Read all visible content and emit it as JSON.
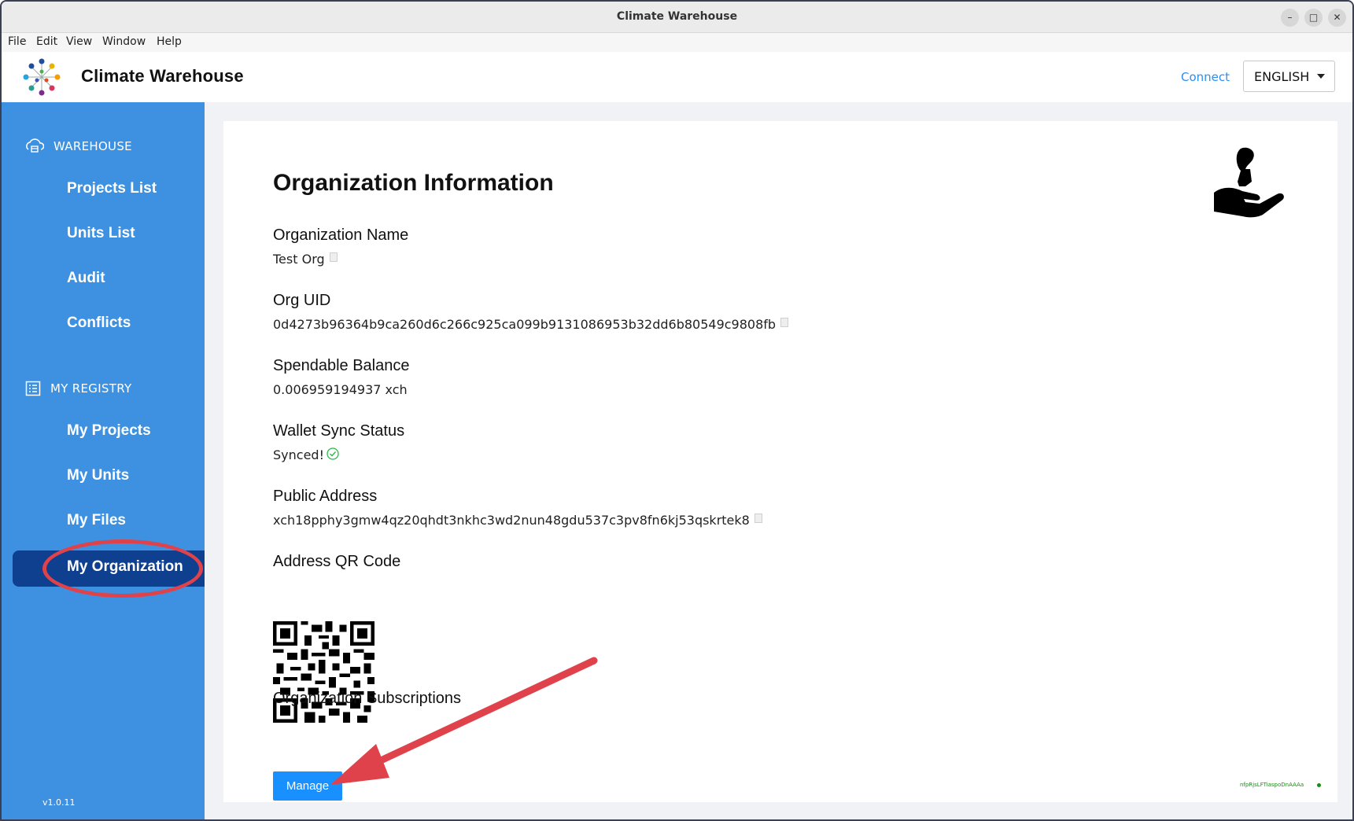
{
  "window": {
    "title": "Climate Warehouse"
  },
  "menu": [
    "File",
    "Edit",
    "View",
    "Window",
    "Help"
  ],
  "header": {
    "app_name": "Climate Warehouse",
    "connect": "Connect",
    "language": "ENGLISH"
  },
  "sidebar": {
    "warehouse_label": "WAREHOUSE",
    "warehouse_items": [
      "Projects List",
      "Units List",
      "Audit",
      "Conflicts"
    ],
    "registry_label": "MY REGISTRY",
    "registry_items": [
      "My Projects",
      "My Units",
      "My Files",
      "My Organization"
    ],
    "active_item": "My Organization",
    "version": "v1.0.11"
  },
  "content": {
    "title": "Organization Information",
    "fields": [
      {
        "label": "Organization Name",
        "value": "Test Org"
      },
      {
        "label": "Org UID",
        "value": "0d4273b96364b9ca260d6c266c925ca099b9131086953b32dd6b80549c9808fb"
      },
      {
        "label": "Spendable Balance",
        "value": "0.006959194937 xch"
      },
      {
        "label": "Wallet Sync Status",
        "value": "Synced!"
      },
      {
        "label": "Public Address",
        "value": "xch18pphy3gmw4qz20qhdt3nkhc3wd2nun48gdu537c3pv8fn6kj53qskrtek8"
      },
      {
        "label": "Address QR Code"
      },
      {
        "label": "Organization Subscriptions"
      }
    ],
    "manage_button": "Manage",
    "footer_hash": "nfpRjsLFTiaspoDnAAAa"
  },
  "colors": {
    "sidebar": "#3d91e0",
    "active": "#0f3f8f",
    "accent": "#1890ff",
    "annotation": "#e0424b",
    "synced": "#2ab94a"
  },
  "icons": [
    "logo-icon",
    "warehouse-icon",
    "registry-icon",
    "copy-icon",
    "check-circle-icon",
    "organization-icon",
    "qr-code",
    "minimize-icon",
    "maximize-icon",
    "close-icon",
    "chevron-down-icon"
  ]
}
